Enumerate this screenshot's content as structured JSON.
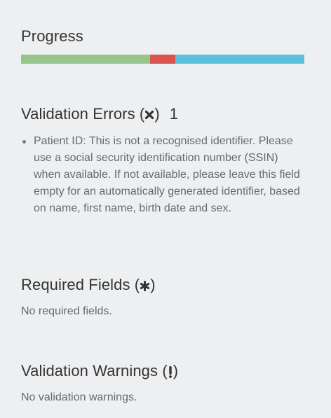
{
  "progress": {
    "title": "Progress",
    "segments": [
      {
        "name": "valid",
        "fraction": 0.455,
        "color": "#96c68b"
      },
      {
        "name": "errors",
        "fraction": 0.089,
        "color": "#d9534f"
      },
      {
        "name": "remaining",
        "fraction": 0.456,
        "color": "#5bc0de"
      }
    ]
  },
  "validation_errors": {
    "title": "Validation Errors",
    "icon": "x-mark-icon",
    "count": "1",
    "items": [
      "Patient ID: This is not a recognised identifier. Please use a social security identification number (SSIN) when available. If not available, please leave this field empty for an automatically generated identifier, based on name, first name, birth date and sex."
    ]
  },
  "required_fields": {
    "title": "Required Fields",
    "icon": "asterisk-icon",
    "message": "No required fields."
  },
  "validation_warnings": {
    "title": "Validation Warnings",
    "icon": "exclamation-icon",
    "message": "No validation warnings."
  }
}
